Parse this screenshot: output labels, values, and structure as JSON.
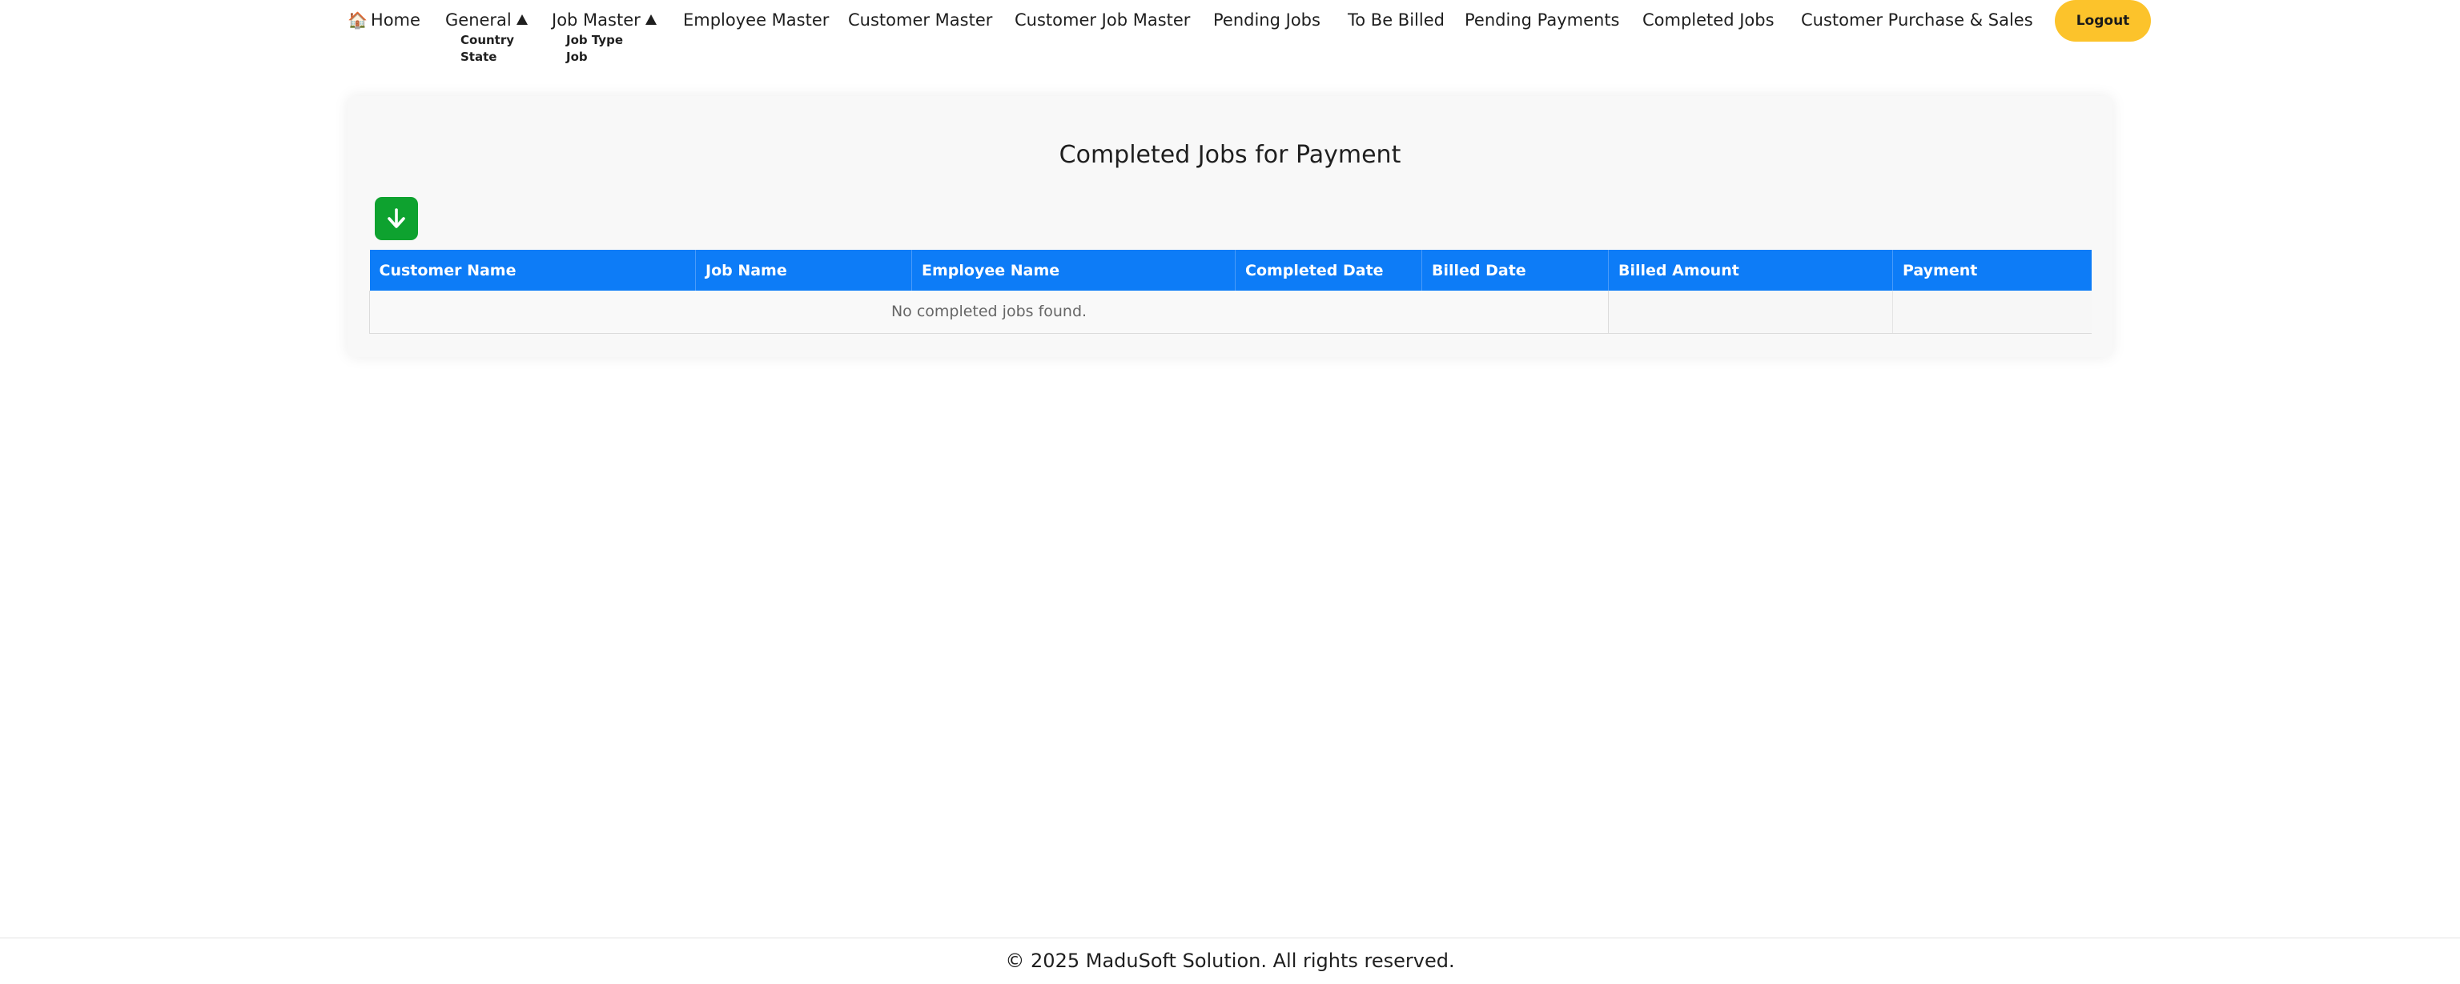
{
  "nav": {
    "home_icon": "house-icon",
    "home_glyph": "🏠",
    "home": "Home",
    "general": "General",
    "general_submenu": [
      "Country",
      "State"
    ],
    "job_master": "Job Master",
    "job_master_submenu": [
      "Job Type",
      "Job"
    ],
    "employee_master": "Employee Master",
    "customer_master": "Customer Master",
    "customer_job_master": "Customer Job Master",
    "pending_jobs": "Pending Jobs",
    "to_be_billed": "To Be Billed",
    "pending_payments": "Pending Payments",
    "completed_jobs": "Completed Jobs",
    "customer_purchase_sales": "Customer Purchase & Sales",
    "logout": "Logout"
  },
  "colors": {
    "logout_button": "#fcc32b",
    "table_header": "#0d7cf7",
    "download_button": "#0ea22f"
  },
  "main": {
    "title": "Completed Jobs for Payment",
    "download_icon": "arrow-down-icon",
    "table": {
      "columns": [
        "Customer Name",
        "Job Name",
        "Employee Name",
        "Completed Date",
        "Billed Date",
        "Billed Amount",
        "Payment"
      ],
      "empty_message": "No completed jobs found."
    }
  },
  "footer": {
    "text": "© 2025 MaduSoft Solution. All rights reserved."
  }
}
